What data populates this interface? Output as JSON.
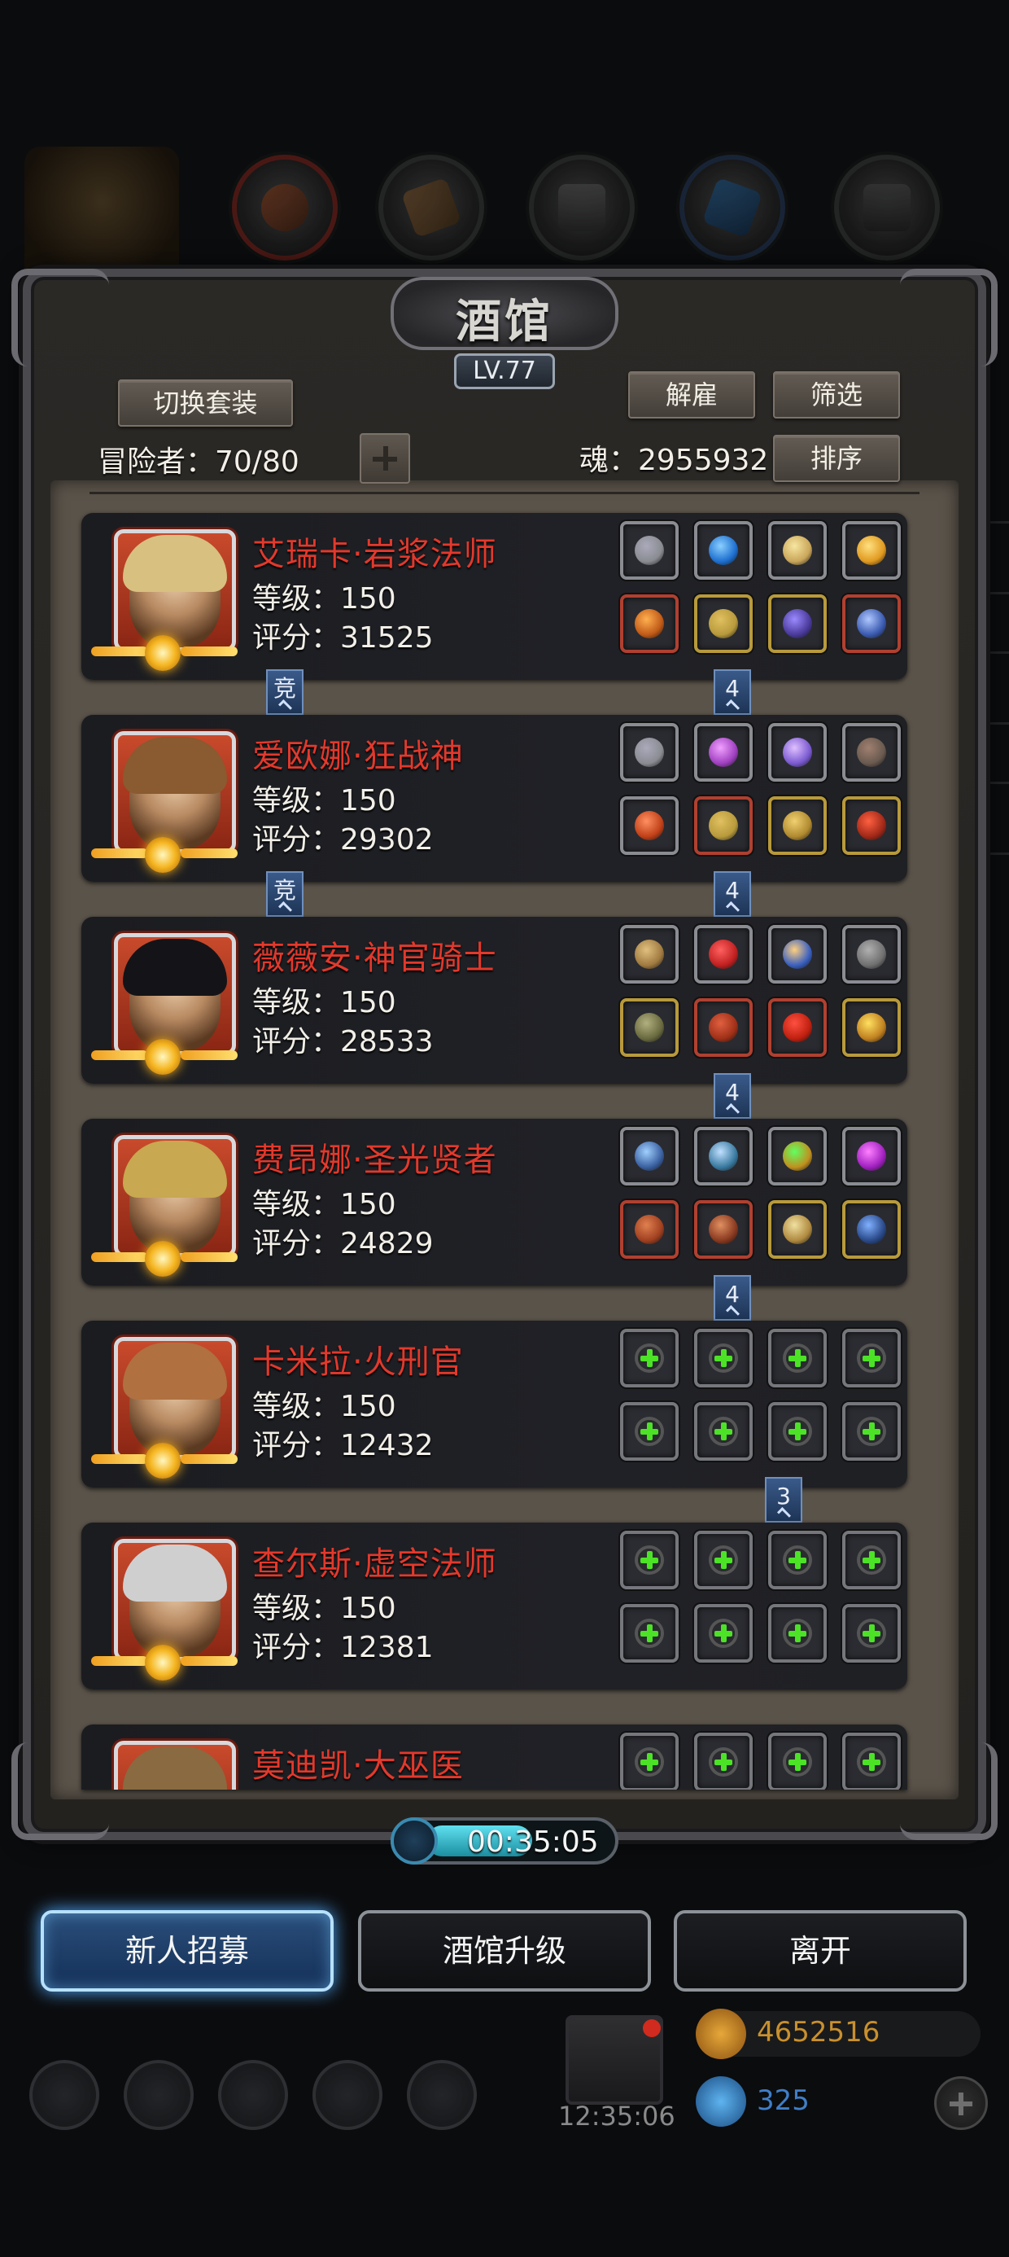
{
  "colors": {
    "hero_name": "#e2392c",
    "accent_blue": "#4fa9ff",
    "plus_green": "#4ce226"
  },
  "header": {
    "title": "酒馆",
    "level": "LV.77",
    "switch_outfit": "切换套装",
    "dismiss": "解雇",
    "filter": "筛选",
    "sort": "排序",
    "adventurers_label": "冒险者：70/80",
    "soul_label": "魂：2955932"
  },
  "heroes": [
    {
      "name": "艾瑞卡·岩浆法师",
      "level": "等级：150",
      "score": "评分：31525",
      "equip": "filled",
      "tag_left": "竞",
      "tag_right": "4"
    },
    {
      "name": "爱欧娜·狂战神",
      "level": "等级：150",
      "score": "评分：29302",
      "equip": "filled",
      "tag_left": "竞",
      "tag_right": "4"
    },
    {
      "name": "薇薇安·神官骑士",
      "level": "等级：150",
      "score": "评分：28533",
      "equip": "filled",
      "tag_right": "4"
    },
    {
      "name": "费昂娜·圣光贤者",
      "level": "等级：150",
      "score": "评分：24829",
      "equip": "filled",
      "tag_right": "4"
    },
    {
      "name": "卡米拉·火刑官",
      "level": "等级：150",
      "score": "评分：12432",
      "equip": "empty",
      "tag_right": "3"
    },
    {
      "name": "查尔斯·虚空法师",
      "level": "等级：150",
      "score": "评分：12381",
      "equip": "empty"
    },
    {
      "name": "莫迪凯·大巫医",
      "equip": "empty"
    }
  ],
  "timer": "00:35:05",
  "buttons": {
    "recruit": "新人招募",
    "upgrade": "酒馆升级",
    "leave": "离开"
  },
  "hud": {
    "chest_timer": "12:35:06",
    "gold": "4652516",
    "gems": "325"
  }
}
